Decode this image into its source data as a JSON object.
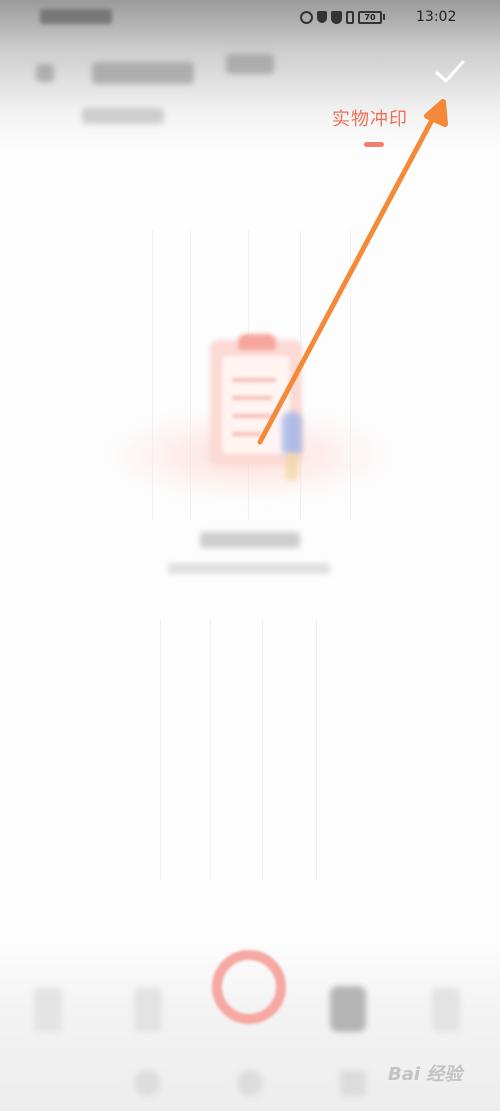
{
  "status_bar": {
    "time": "13:02",
    "battery_level": "70"
  },
  "header": {
    "confirm_icon": "check-icon",
    "active_tab_label": "实物冲印"
  },
  "bottom_toolbar": {
    "shutter_icon": "shutter-ring-icon"
  },
  "watermark": {
    "text": "Bai 经验"
  },
  "colors": {
    "accent": "#f07055",
    "arrow": "#f5893a",
    "shutter": "#f6a8a2"
  }
}
